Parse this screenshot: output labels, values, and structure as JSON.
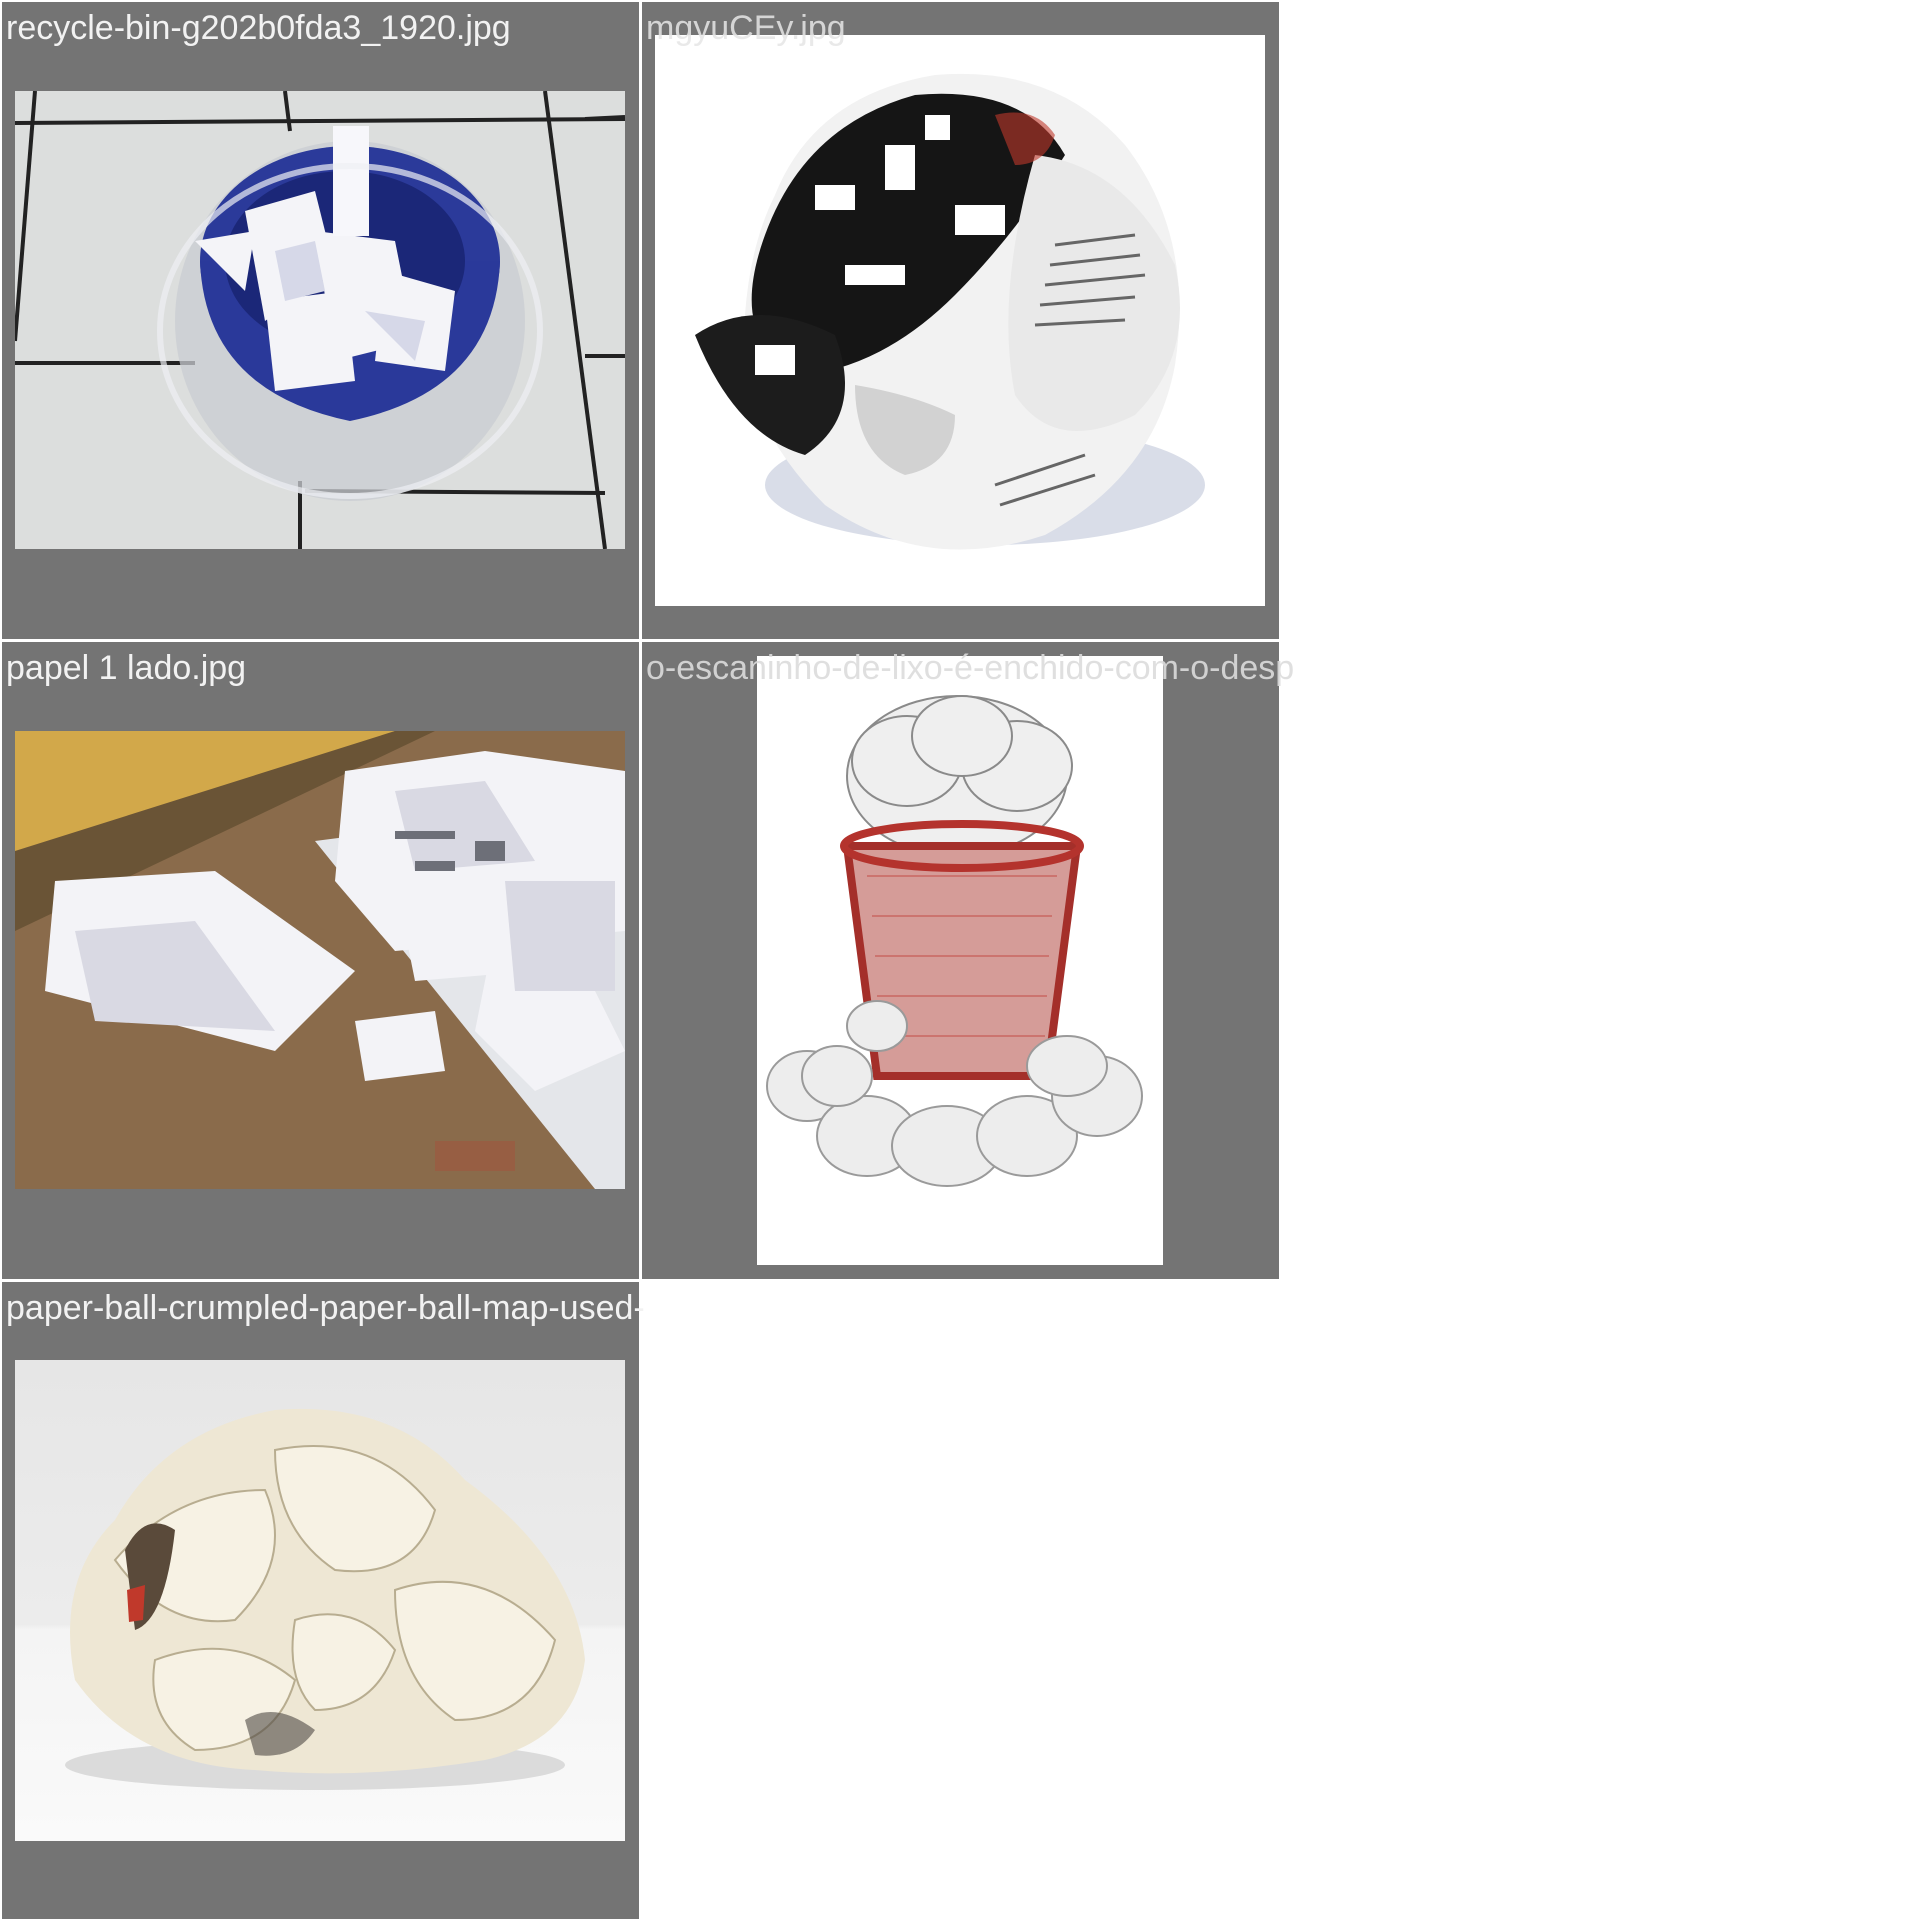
{
  "gallery": {
    "items": [
      {
        "filename": "recycle-bin-g202b0fda3_1920.jpg",
        "image": "trash-bin-with-paper-photo"
      },
      {
        "filename": "mgyuCEy.jpg",
        "image": "crumpled-newspaper-ball-photo"
      },
      {
        "filename": "papel 1 lado.jpg",
        "image": "paper-sheets-on-floor-photo"
      },
      {
        "filename": "o-escaninho-de-lixo-e-enchido-com-o-desp",
        "filename_display": "o-escaninho-de-lixo-é-enchido-com-o-desp",
        "image": "red-mesh-bin-paper-balls-photo"
      },
      {
        "filename": "paper-ball-crumpled-paper-ball-map-used-",
        "image": "crumpled-paper-ball-photo"
      }
    ]
  },
  "colors": {
    "tile_background": "#747474",
    "page_background": "#ffffff",
    "caption_text": "#f2f2f2"
  }
}
